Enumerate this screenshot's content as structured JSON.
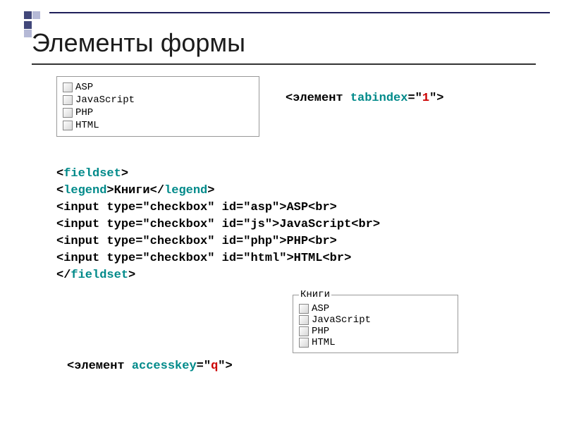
{
  "title": "Элементы формы",
  "box1": {
    "items": [
      "ASP",
      "JavaScript",
      "PHP",
      "HTML"
    ]
  },
  "tabindex": {
    "open": "<",
    "elem": "элемент ",
    "attr": "tabindex",
    "eq": "=\"",
    "val": "1",
    "close": "\">"
  },
  "code": {
    "l1": {
      "open": "<",
      "tag": "fieldset",
      "close": ">"
    },
    "l2": {
      "open": "<",
      "tag": "legend",
      "close": ">",
      "text": "Книги",
      "open2": "</",
      "tag2": "legend",
      "close2": ">"
    },
    "l3": {
      "raw": "<input type=\"checkbox\" id=\"asp\">ASP<br>"
    },
    "l4": {
      "raw": "<input type=\"checkbox\" id=\"js\">JavaScript<br>"
    },
    "l5": {
      "raw": "<input type=\"checkbox\" id=\"php\">PHP<br>"
    },
    "l6": {
      "raw": "<input type=\"checkbox\" id=\"html\">HTML<br>"
    },
    "l7": {
      "open": "</",
      "tag": "fieldset",
      "close": ">"
    }
  },
  "fieldset_box": {
    "legend": "Книги",
    "items": [
      "ASP",
      "JavaScript",
      "PHP",
      "HTML"
    ]
  },
  "accesskey": {
    "open": "<",
    "elem": "элемент ",
    "attr": "accesskey",
    "eq": "=\"",
    "val": "q",
    "close": "\">"
  }
}
